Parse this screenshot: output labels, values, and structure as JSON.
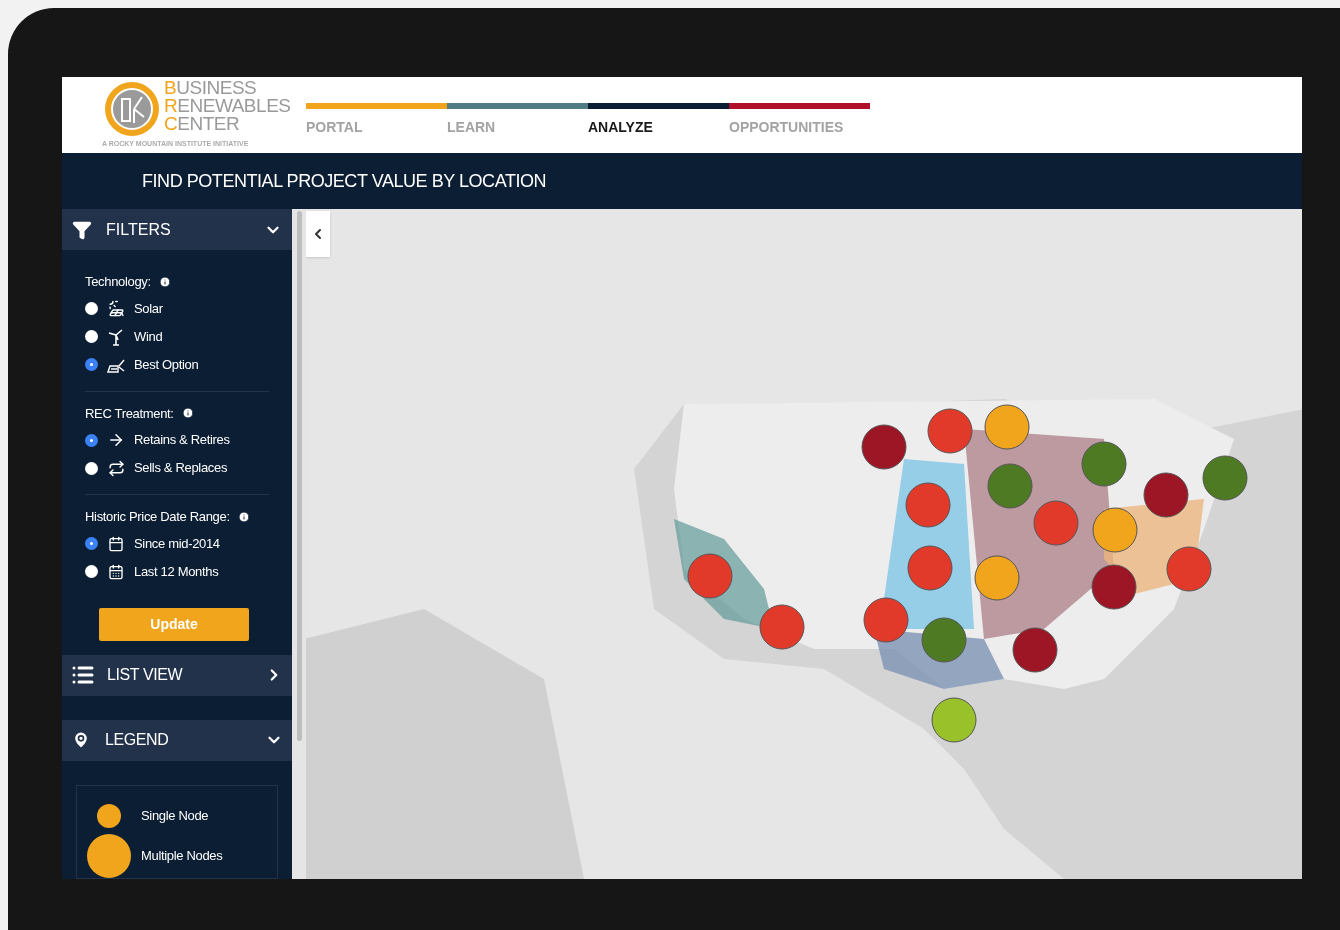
{
  "logo": {
    "lines": [
      {
        "initial": "B",
        "rest": "USINESS"
      },
      {
        "initial": "R",
        "rest": "ENEWABLES"
      },
      {
        "initial": "C",
        "rest": "ENTER"
      }
    ],
    "tagline": "A ROCKY MOUNTAIN INSTITUTE INITIATIVE"
  },
  "nav": [
    {
      "label": "PORTAL",
      "color": "#f0a51c",
      "selected": false
    },
    {
      "label": "LEARN",
      "color": "#4f7d83",
      "selected": false
    },
    {
      "label": "ANALYZE",
      "color": "#0c1e33",
      "selected": true
    },
    {
      "label": "OPPORTUNITIES",
      "color": "#b0102a",
      "selected": false
    }
  ],
  "page_title": "FIND POTENTIAL PROJECT VALUE BY LOCATION",
  "filters": {
    "title": "FILTERS",
    "expanded": true,
    "groups": [
      {
        "label": "Technology:",
        "options": [
          {
            "label": "Solar",
            "kind": "solar",
            "selected": false
          },
          {
            "label": "Wind",
            "kind": "wind",
            "selected": false
          },
          {
            "label": "Best Option",
            "kind": "best",
            "selected": true
          }
        ]
      },
      {
        "label": "REC Treatment:",
        "options": [
          {
            "label": "Retains & Retires",
            "kind": "retain",
            "selected": true
          },
          {
            "label": "Sells & Replaces",
            "kind": "replace",
            "selected": false
          }
        ]
      },
      {
        "label": "Historic Price Date Range:",
        "options": [
          {
            "label": "Since mid-2014",
            "kind": "since",
            "selected": true
          },
          {
            "label": "Last 12 Months",
            "kind": "months",
            "selected": false
          }
        ]
      }
    ],
    "button": "Update"
  },
  "list_view": {
    "title": "LIST VIEW",
    "expanded": false
  },
  "legend": {
    "title": "LEGEND",
    "expanded": true,
    "items": [
      {
        "label": "Single Node",
        "kind": "small"
      },
      {
        "label": "Multiple Nodes",
        "kind": "large"
      }
    ]
  }
}
